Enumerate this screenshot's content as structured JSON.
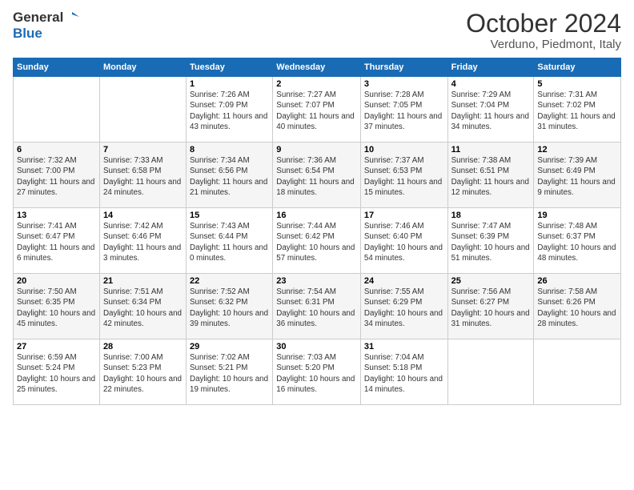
{
  "header": {
    "logo_general": "General",
    "logo_blue": "Blue",
    "month": "October 2024",
    "location": "Verduno, Piedmont, Italy"
  },
  "days_of_week": [
    "Sunday",
    "Monday",
    "Tuesday",
    "Wednesday",
    "Thursday",
    "Friday",
    "Saturday"
  ],
  "weeks": [
    [
      {
        "day": "",
        "sunrise": "",
        "sunset": "",
        "daylight": ""
      },
      {
        "day": "",
        "sunrise": "",
        "sunset": "",
        "daylight": ""
      },
      {
        "day": "1",
        "sunrise": "Sunrise: 7:26 AM",
        "sunset": "Sunset: 7:09 PM",
        "daylight": "Daylight: 11 hours and 43 minutes."
      },
      {
        "day": "2",
        "sunrise": "Sunrise: 7:27 AM",
        "sunset": "Sunset: 7:07 PM",
        "daylight": "Daylight: 11 hours and 40 minutes."
      },
      {
        "day": "3",
        "sunrise": "Sunrise: 7:28 AM",
        "sunset": "Sunset: 7:05 PM",
        "daylight": "Daylight: 11 hours and 37 minutes."
      },
      {
        "day": "4",
        "sunrise": "Sunrise: 7:29 AM",
        "sunset": "Sunset: 7:04 PM",
        "daylight": "Daylight: 11 hours and 34 minutes."
      },
      {
        "day": "5",
        "sunrise": "Sunrise: 7:31 AM",
        "sunset": "Sunset: 7:02 PM",
        "daylight": "Daylight: 11 hours and 31 minutes."
      }
    ],
    [
      {
        "day": "6",
        "sunrise": "Sunrise: 7:32 AM",
        "sunset": "Sunset: 7:00 PM",
        "daylight": "Daylight: 11 hours and 27 minutes."
      },
      {
        "day": "7",
        "sunrise": "Sunrise: 7:33 AM",
        "sunset": "Sunset: 6:58 PM",
        "daylight": "Daylight: 11 hours and 24 minutes."
      },
      {
        "day": "8",
        "sunrise": "Sunrise: 7:34 AM",
        "sunset": "Sunset: 6:56 PM",
        "daylight": "Daylight: 11 hours and 21 minutes."
      },
      {
        "day": "9",
        "sunrise": "Sunrise: 7:36 AM",
        "sunset": "Sunset: 6:54 PM",
        "daylight": "Daylight: 11 hours and 18 minutes."
      },
      {
        "day": "10",
        "sunrise": "Sunrise: 7:37 AM",
        "sunset": "Sunset: 6:53 PM",
        "daylight": "Daylight: 11 hours and 15 minutes."
      },
      {
        "day": "11",
        "sunrise": "Sunrise: 7:38 AM",
        "sunset": "Sunset: 6:51 PM",
        "daylight": "Daylight: 11 hours and 12 minutes."
      },
      {
        "day": "12",
        "sunrise": "Sunrise: 7:39 AM",
        "sunset": "Sunset: 6:49 PM",
        "daylight": "Daylight: 11 hours and 9 minutes."
      }
    ],
    [
      {
        "day": "13",
        "sunrise": "Sunrise: 7:41 AM",
        "sunset": "Sunset: 6:47 PM",
        "daylight": "Daylight: 11 hours and 6 minutes."
      },
      {
        "day": "14",
        "sunrise": "Sunrise: 7:42 AM",
        "sunset": "Sunset: 6:46 PM",
        "daylight": "Daylight: 11 hours and 3 minutes."
      },
      {
        "day": "15",
        "sunrise": "Sunrise: 7:43 AM",
        "sunset": "Sunset: 6:44 PM",
        "daylight": "Daylight: 11 hours and 0 minutes."
      },
      {
        "day": "16",
        "sunrise": "Sunrise: 7:44 AM",
        "sunset": "Sunset: 6:42 PM",
        "daylight": "Daylight: 10 hours and 57 minutes."
      },
      {
        "day": "17",
        "sunrise": "Sunrise: 7:46 AM",
        "sunset": "Sunset: 6:40 PM",
        "daylight": "Daylight: 10 hours and 54 minutes."
      },
      {
        "day": "18",
        "sunrise": "Sunrise: 7:47 AM",
        "sunset": "Sunset: 6:39 PM",
        "daylight": "Daylight: 10 hours and 51 minutes."
      },
      {
        "day": "19",
        "sunrise": "Sunrise: 7:48 AM",
        "sunset": "Sunset: 6:37 PM",
        "daylight": "Daylight: 10 hours and 48 minutes."
      }
    ],
    [
      {
        "day": "20",
        "sunrise": "Sunrise: 7:50 AM",
        "sunset": "Sunset: 6:35 PM",
        "daylight": "Daylight: 10 hours and 45 minutes."
      },
      {
        "day": "21",
        "sunrise": "Sunrise: 7:51 AM",
        "sunset": "Sunset: 6:34 PM",
        "daylight": "Daylight: 10 hours and 42 minutes."
      },
      {
        "day": "22",
        "sunrise": "Sunrise: 7:52 AM",
        "sunset": "Sunset: 6:32 PM",
        "daylight": "Daylight: 10 hours and 39 minutes."
      },
      {
        "day": "23",
        "sunrise": "Sunrise: 7:54 AM",
        "sunset": "Sunset: 6:31 PM",
        "daylight": "Daylight: 10 hours and 36 minutes."
      },
      {
        "day": "24",
        "sunrise": "Sunrise: 7:55 AM",
        "sunset": "Sunset: 6:29 PM",
        "daylight": "Daylight: 10 hours and 34 minutes."
      },
      {
        "day": "25",
        "sunrise": "Sunrise: 7:56 AM",
        "sunset": "Sunset: 6:27 PM",
        "daylight": "Daylight: 10 hours and 31 minutes."
      },
      {
        "day": "26",
        "sunrise": "Sunrise: 7:58 AM",
        "sunset": "Sunset: 6:26 PM",
        "daylight": "Daylight: 10 hours and 28 minutes."
      }
    ],
    [
      {
        "day": "27",
        "sunrise": "Sunrise: 6:59 AM",
        "sunset": "Sunset: 5:24 PM",
        "daylight": "Daylight: 10 hours and 25 minutes."
      },
      {
        "day": "28",
        "sunrise": "Sunrise: 7:00 AM",
        "sunset": "Sunset: 5:23 PM",
        "daylight": "Daylight: 10 hours and 22 minutes."
      },
      {
        "day": "29",
        "sunrise": "Sunrise: 7:02 AM",
        "sunset": "Sunset: 5:21 PM",
        "daylight": "Daylight: 10 hours and 19 minutes."
      },
      {
        "day": "30",
        "sunrise": "Sunrise: 7:03 AM",
        "sunset": "Sunset: 5:20 PM",
        "daylight": "Daylight: 10 hours and 16 minutes."
      },
      {
        "day": "31",
        "sunrise": "Sunrise: 7:04 AM",
        "sunset": "Sunset: 5:18 PM",
        "daylight": "Daylight: 10 hours and 14 minutes."
      },
      {
        "day": "",
        "sunrise": "",
        "sunset": "",
        "daylight": ""
      },
      {
        "day": "",
        "sunrise": "",
        "sunset": "",
        "daylight": ""
      }
    ]
  ]
}
